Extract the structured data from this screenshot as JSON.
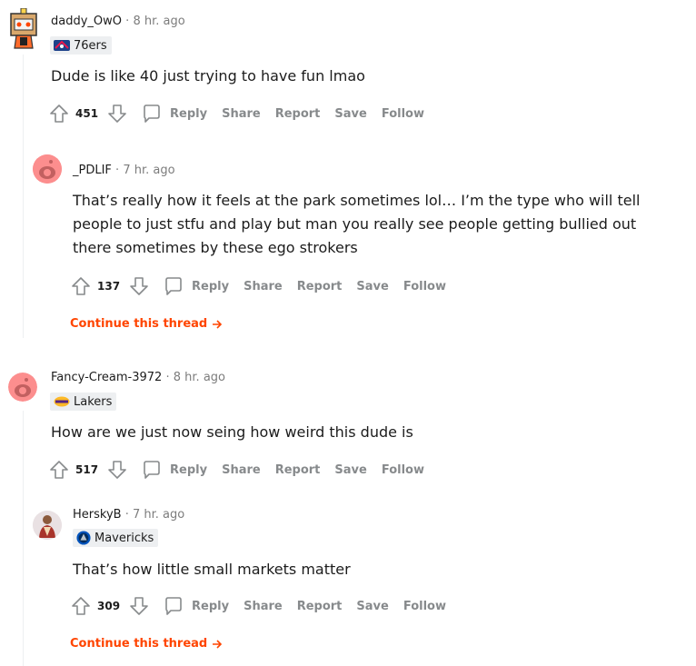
{
  "comments": [
    {
      "author": "daddy_OwO",
      "time": "8 hr. ago",
      "flair": "76ers",
      "body": "Dude is like 40 just trying to have fun lmao",
      "score": "451"
    },
    {
      "author": "_PDLIF",
      "time": "7 hr. ago",
      "body": "That’s really how it feels at the park sometimes lol… I’m the type who will tell people to just stfu and play but man you really see people getting bullied out there sometimes by these ego strokers",
      "score": "137"
    },
    {
      "author": "Fancy-Cream-3972",
      "time": "8 hr. ago",
      "flair": "Lakers",
      "body": "How are we just now seing how weird this dude is",
      "score": "517"
    },
    {
      "author": "HerskyB",
      "time": "7 hr. ago",
      "flair": "Mavericks",
      "body": "That’s how little small markets matter",
      "score": "309"
    }
  ],
  "actions": {
    "reply": "Reply",
    "share": "Share",
    "report": "Report",
    "save": "Save",
    "follow": "Follow"
  },
  "continue_thread": "Continue this thread",
  "separator": "·",
  "icons": {
    "upvote": "upvote-arrow-icon",
    "downvote": "downvote-arrow-icon",
    "reply": "chat-bubble-icon",
    "continue": "arrow-right-icon"
  },
  "colors": {
    "accent": "#ff4500",
    "muted": "#878a8c",
    "text": "#1c1c1c",
    "flair_bg": "#edeff1"
  }
}
